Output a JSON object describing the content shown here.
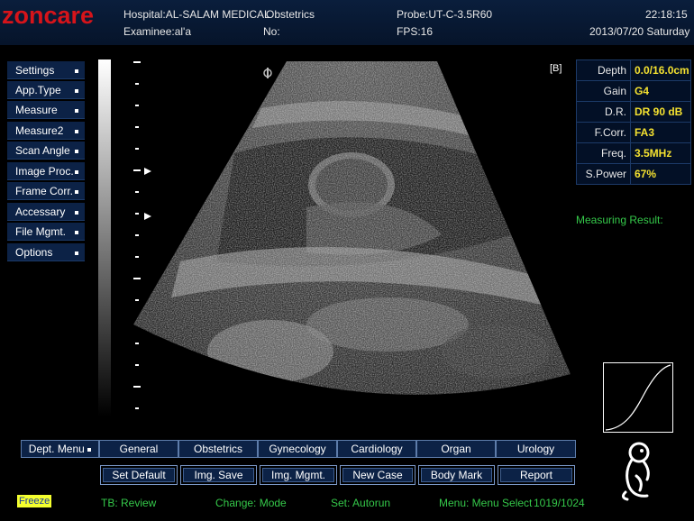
{
  "header": {
    "logo": "zoncare",
    "hospital": "Hospital:AL-SALAM MEDICAL",
    "exam_type": "Obstetrics",
    "examinee": "Examinee:al'a",
    "no": "No:",
    "probe": "Probe:UT-C-3.5R60",
    "fps": "FPS:16",
    "time": "22:18:15",
    "date": "2013/07/20 Saturday"
  },
  "left_menu": [
    "Settings",
    "App.Type",
    "Measure",
    "Measure2",
    "Scan Angle",
    "Image Proc.",
    "Frame Corr.",
    "Accessary",
    "File Mgmt.",
    "Options"
  ],
  "image": {
    "mode_label": "[B]"
  },
  "params": [
    {
      "label": "Depth",
      "value": "0.0/16.0cm"
    },
    {
      "label": "Gain",
      "value": "G4"
    },
    {
      "label": "D.R.",
      "value": "DR 90 dB"
    },
    {
      "label": "F.Corr.",
      "value": "FA3"
    },
    {
      "label": "Freq.",
      "value": "3.5MHz"
    },
    {
      "label": "S.Power",
      "value": "67%"
    }
  ],
  "measuring_result": "Measuring Result:",
  "tabs": [
    "Dept. Menu",
    "General",
    "Obstetrics",
    "Gynecology",
    "Cardiology",
    "Organ",
    "Urology"
  ],
  "buttons": [
    "Set Default",
    "Img. Save",
    "Img. Mgmt.",
    "New Case",
    "Body Mark",
    "Report"
  ],
  "status": {
    "freeze": "Freeze",
    "tb": "TB: Review",
    "change": "Change: Mode",
    "set": "Set: Autorun",
    "menu": "Menu: Menu Select",
    "frames": "1019/1024"
  },
  "colors": {
    "accent": "#f4e130",
    "green": "#35c94a",
    "panel": "#0c2246",
    "logo": "#d6141a"
  }
}
